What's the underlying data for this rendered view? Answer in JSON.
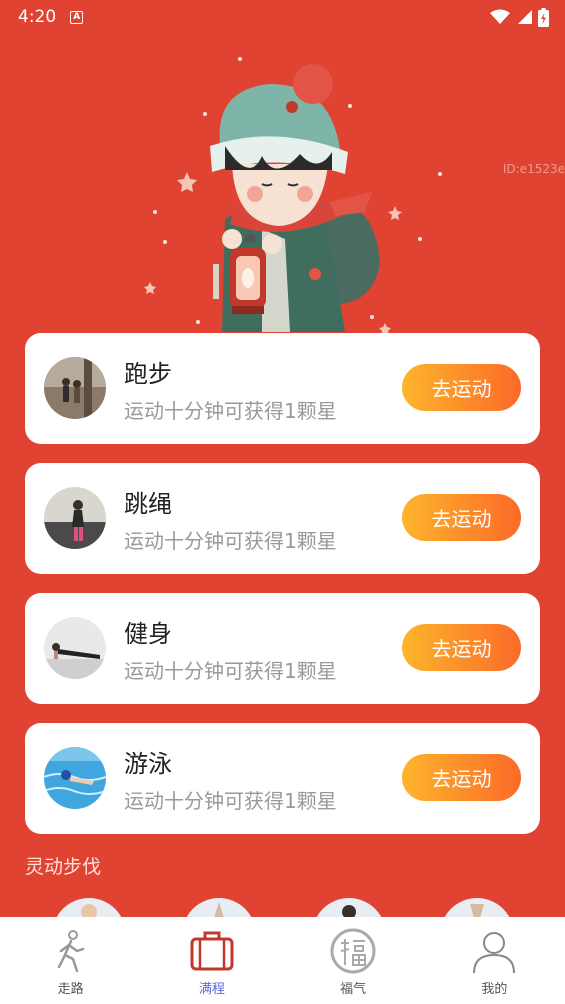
{
  "status_bar": {
    "time": "4:20",
    "notification_icon": "A",
    "icons": [
      "wifi-icon",
      "signal-icon",
      "battery-icon"
    ]
  },
  "hero": {
    "id_text": "ID:e1523e"
  },
  "activities": [
    {
      "title": "跑步",
      "desc": "运动十分钟可获得1颗星",
      "button": "去运动",
      "thumb": "running-photo"
    },
    {
      "title": "跳绳",
      "desc": "运动十分钟可获得1颗星",
      "button": "去运动",
      "thumb": "jump-rope-photo"
    },
    {
      "title": "健身",
      "desc": "运动十分钟可获得1颗星",
      "button": "去运动",
      "thumb": "plank-photo"
    },
    {
      "title": "游泳",
      "desc": "运动十分钟可获得1颗星",
      "button": "去运动",
      "thumb": "swimming-photo"
    }
  ],
  "section": {
    "title": "灵动步伐"
  },
  "tabs": [
    {
      "label": "走路",
      "icon": "walking-icon",
      "active": false
    },
    {
      "label": "满程",
      "icon": "suitcase-icon",
      "active": true
    },
    {
      "label": "福气",
      "icon": "fu-seal-icon",
      "active": false
    },
    {
      "label": "我的",
      "icon": "user-icon",
      "active": false
    }
  ],
  "colors": {
    "background": "#e04332",
    "button_gradient_start": "#fdb52b",
    "button_gradient_end": "#fb6a2a",
    "active_tab": "#5c6bd6"
  }
}
